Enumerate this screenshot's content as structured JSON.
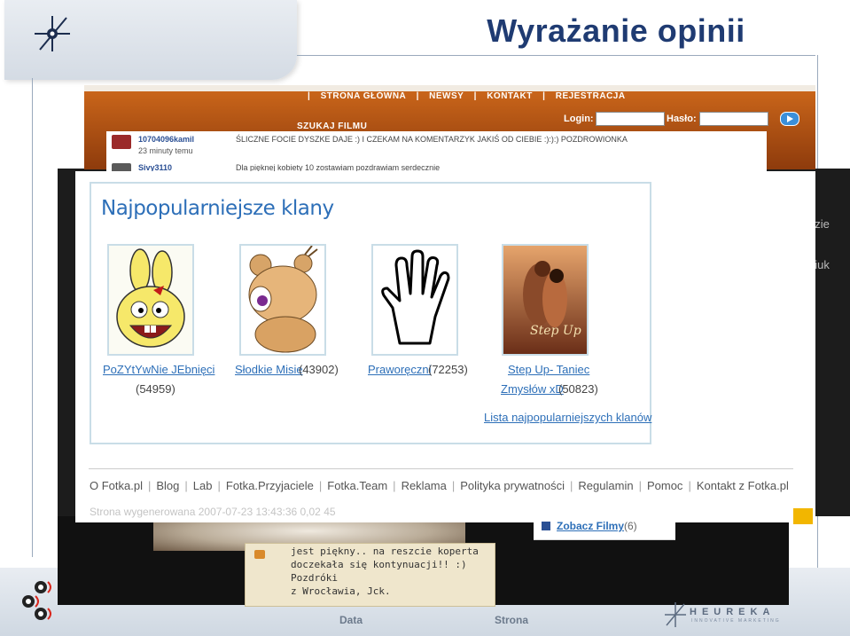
{
  "slide": {
    "title": "Wyrażanie opinii"
  },
  "site": {
    "nav": [
      "STRONA GŁÓWNA",
      "NEWSY",
      "KONTAKT",
      "REJESTRACJA"
    ],
    "nav_separator": "|",
    "search_label": "SZUKAJ FILMU",
    "login_label": "Login:",
    "password_label": "Hasło:"
  },
  "comments": [
    {
      "user": "10704096kamil",
      "time": "23 minuty temu",
      "text": "ŚLICZNE FOCIE DYSZKE DAJE :) I CZEKAM NA KOMENTARZYK JAKIŚ OD CIEBIE :):):) POZDROWIONKA"
    },
    {
      "user": "Sivy3110",
      "time": "",
      "text": "Dla pięknej kobiety 10 zostawiam pozdrawiam serdecznie"
    }
  ],
  "dark_side": {
    "text1": "dzie",
    "text2": "piuk"
  },
  "clans": {
    "heading": "Najpopularniejsze klany",
    "items": [
      {
        "name": "PoZYtYwNie JEbnięci",
        "count": "(54959)"
      },
      {
        "name": "Słodkie Misie",
        "count": "(43902)"
      },
      {
        "name": "Praworęczni",
        "count": "(72253)"
      },
      {
        "name_line1": "Step Up- Taniec",
        "name_line2": "Zmysłów xD",
        "count": "(50823)",
        "poster_text": "Step Up"
      }
    ],
    "more_link": "Lista najpopularniejszych klanów"
  },
  "footer": {
    "links": [
      "O Fotka.pl",
      "Blog",
      "Lab",
      "Fotka.Przyjaciele",
      "Fotka.Team",
      "Reklama",
      "Polityka prywatności",
      "Regulamin",
      "Pomoc",
      "Kontakt z Fotka.pl"
    ],
    "separator": "|",
    "generated": "Strona wygenerowana 2007-07-23 13:43:36 0,02 45"
  },
  "films": {
    "link": "Zobacz Filmy",
    "count": "(6)"
  },
  "note": {
    "text": "jest piękny.. na reszcie koperta\ndoczekała się kontynuacji!! :) Pozdróki\nz Wrocławia, Jck."
  },
  "bottom_labels": {
    "data": "Data",
    "strona": "Strona"
  },
  "heureka": {
    "name": "HEUREKA",
    "tagline": "INNOVATIVE MARKETING"
  },
  "colors": {
    "title": "#1f3b72",
    "link": "#2d6fb8",
    "header_orange": "#c9651a",
    "box_border": "#c9dde7"
  },
  "icons": [
    "star-logo-icon",
    "speaker-icons",
    "login-go-icon",
    "films-icon"
  ]
}
